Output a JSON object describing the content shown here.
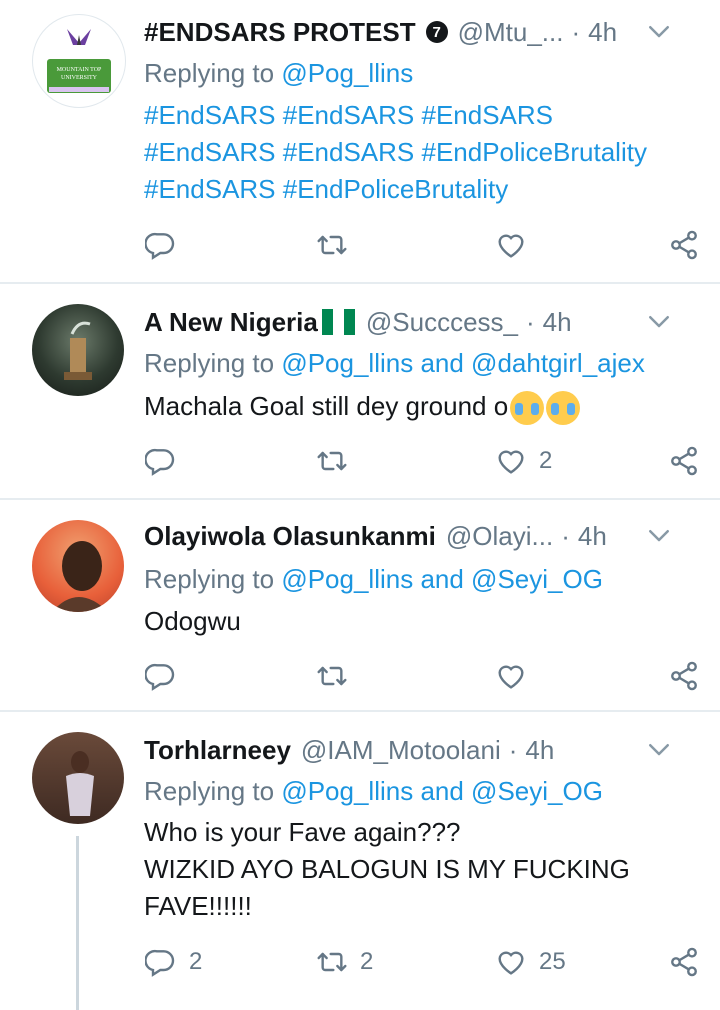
{
  "colors": {
    "accent": "#1b95e0",
    "muted": "#657786",
    "text": "#14171a",
    "separator": "#e6ecf0"
  },
  "tweets": [
    {
      "name": "#ENDSARS PROTEST",
      "badge": "7",
      "handle": "@Mtu_...",
      "time": "4h",
      "reply_prefix": "Replying to",
      "reply_mentions": "@Pog_llins",
      "text_lines": [
        "#EndSARS #EndSARS #EndSARS",
        "#EndSARS #EndSARS #EndPoliceBrutality",
        "#EndSARS #EndPoliceBrutality"
      ],
      "avatar_desc": "university-logo-avatar",
      "avatar_lettering": "MOUNTAIN TOP UNIVERSITY",
      "counts": {
        "reply": "",
        "retweet": "",
        "like": ""
      }
    },
    {
      "name": "A New Nigeria",
      "handle": "@Succcess_",
      "time": "4h",
      "reply_prefix": "Replying to",
      "reply_mentions": "@Pog_llins and @dahtgirl_ajex",
      "text_lines": [
        "Machala Goal still dey ground o"
      ],
      "counts": {
        "reply": "",
        "retweet": "",
        "like": "2"
      }
    },
    {
      "name": "Olayiwola Olasunkanmi",
      "handle": "@Olayi...",
      "time": "4h",
      "reply_prefix": "Replying to",
      "reply_mentions": "@Pog_llins and @Seyi_OG",
      "text_lines": [
        "Odogwu"
      ],
      "counts": {
        "reply": "",
        "retweet": "",
        "like": ""
      }
    },
    {
      "name": "Torhlarneey",
      "handle": "@IAM_Motoolani",
      "time": "4h",
      "reply_prefix": "Replying to",
      "reply_mentions": "@Pog_llins and @Seyi_OG",
      "text_lines": [
        "Who is your Fave again???",
        "WIZKID AYO BALOGUN IS MY FUCKING",
        "FAVE!!!!!!"
      ],
      "counts": {
        "reply": "2",
        "retweet": "2",
        "like": "25"
      }
    }
  ],
  "separator_dot": "·"
}
